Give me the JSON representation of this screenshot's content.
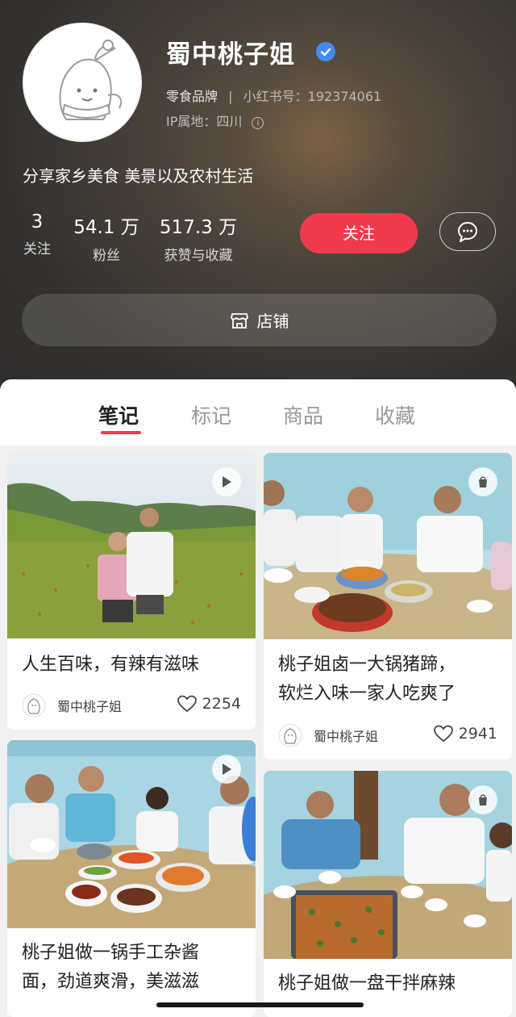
{
  "profile": {
    "name": "蜀中桃子姐",
    "category": "零食品牌",
    "separator": "|",
    "id_label": "小红书号：192374061",
    "ip_label": "IP属地：四川",
    "bio": "分享家乡美食 美景以及农村生活",
    "stats": [
      {
        "value": "3",
        "label": "关注"
      },
      {
        "value": "54.1 万",
        "label": "粉丝"
      },
      {
        "value": "517.3 万",
        "label": "获赞与收藏"
      }
    ],
    "follow_label": "关注",
    "store_label": "店铺",
    "icons": {
      "verified": "verified-check-icon",
      "info": "info-icon",
      "chat": "chat-bubble-icon",
      "store": "store-icon"
    }
  },
  "tabs": [
    {
      "label": "笔记",
      "active": true
    },
    {
      "label": "标记",
      "active": false
    },
    {
      "label": "商品",
      "active": false
    },
    {
      "label": "收藏",
      "active": false
    }
  ],
  "notes": [
    {
      "title": "人生百味，有辣有滋味",
      "author": "蜀中桃子姐",
      "likes": "2254",
      "badge": "play-icon"
    },
    {
      "title": "桃子姐卤一大锅猪蹄，软烂入味一家人吃爽了",
      "title_line1": "桃子姐卤一大锅猪蹄，",
      "title_line2": "软烂入味一家人吃爽了",
      "author": "蜀中桃子姐",
      "likes": "2941",
      "badge": "shopping-bag-icon"
    },
    {
      "title": "桃子姐做一锅手工杂酱面，劲道爽滑，美滋滋",
      "title_line1": "桃子姐做一锅手工杂酱",
      "title_line2": "面，劲道爽滑，美滋滋",
      "badge": "play-icon"
    },
    {
      "title": "桃子姐做一盘干拌麻辣",
      "badge": "shopping-bag-icon"
    }
  ],
  "colors": {
    "accent": "#f23a4e",
    "header_bg": "#343230",
    "verified": "#3f8df4"
  }
}
